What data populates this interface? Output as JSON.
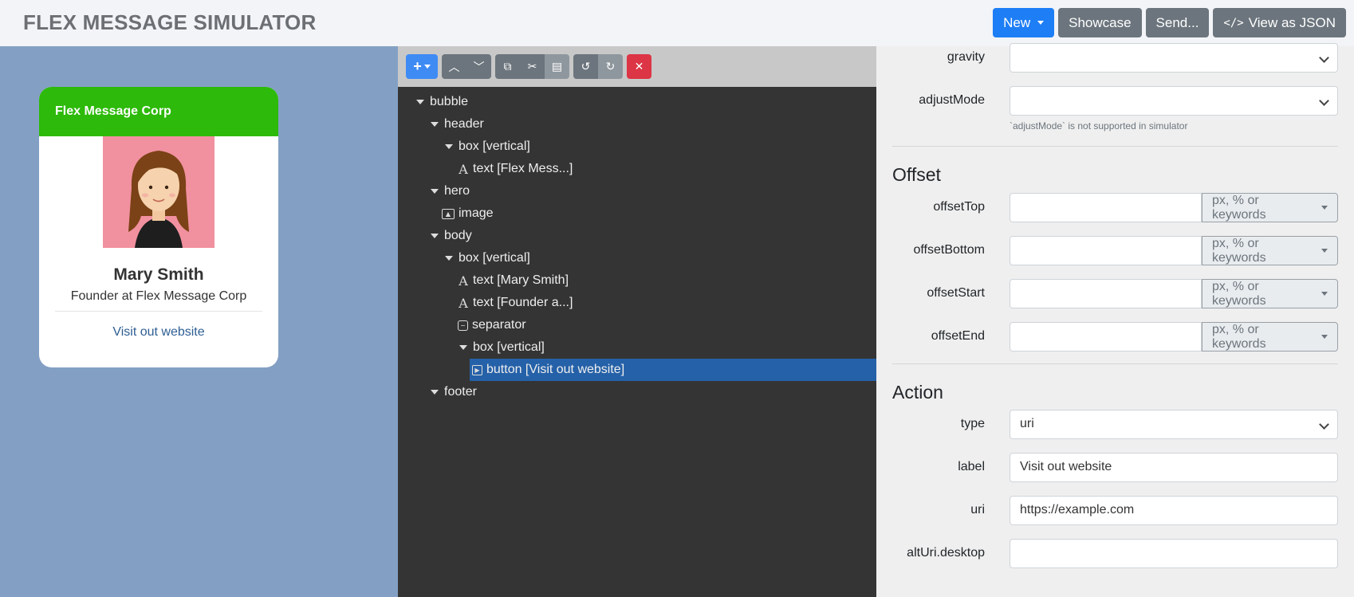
{
  "app": {
    "title": "FLEX MESSAGE SIMULATOR",
    "buttons": {
      "new": "New",
      "showcase": "Showcase",
      "send": "Send...",
      "view_json": "View as JSON"
    }
  },
  "preview": {
    "header_text": "Flex Message Corp",
    "name": "Mary Smith",
    "role": "Founder at Flex Message Corp",
    "link": "Visit out website"
  },
  "tree": [
    {
      "label": "bubble",
      "icon": "caret-down"
    },
    {
      "label": "header",
      "icon": "caret-down"
    },
    {
      "label": "box [vertical]",
      "icon": "caret-down"
    },
    {
      "label": "text [Flex Mess...]",
      "icon": "text-icon"
    },
    {
      "label": "hero",
      "icon": "caret-down"
    },
    {
      "label": "image",
      "icon": "image-icon"
    },
    {
      "label": "body",
      "icon": "caret-down"
    },
    {
      "label": "box [vertical]",
      "icon": "caret-down"
    },
    {
      "label": "text [Mary Smith]",
      "icon": "text-icon"
    },
    {
      "label": "text [Founder a...]",
      "icon": "text-icon"
    },
    {
      "label": "separator",
      "icon": "separator-icon"
    },
    {
      "label": "box [vertical]",
      "icon": "caret-down"
    },
    {
      "label": "button [Visit out website]",
      "icon": "button-icon",
      "selected": true
    },
    {
      "label": "footer",
      "icon": "caret-down"
    }
  ],
  "props": {
    "gravity": {
      "label": "gravity",
      "value": ""
    },
    "adjustMode": {
      "label": "adjustMode",
      "value": "",
      "hint": "`adjustMode` is not supported in simulator"
    },
    "offset": {
      "title": "Offset",
      "unit_label": "px, % or keywords",
      "fields": {
        "top": "offsetTop",
        "bottom": "offsetBottom",
        "start": "offsetStart",
        "end": "offsetEnd"
      }
    },
    "action": {
      "title": "Action",
      "type_label": "type",
      "type_value": "uri",
      "label_label": "label",
      "label_value": "Visit out website",
      "uri_label": "uri",
      "uri_value": "https://example.com",
      "alturi_label": "altUri.desktop",
      "alturi_value": ""
    }
  },
  "colors": {
    "header_green": "#2dba0a",
    "preview_bg": "#83a0c4",
    "tree_bg": "#343434",
    "selected": "#2561a8",
    "primary": "#1e7ef5"
  }
}
